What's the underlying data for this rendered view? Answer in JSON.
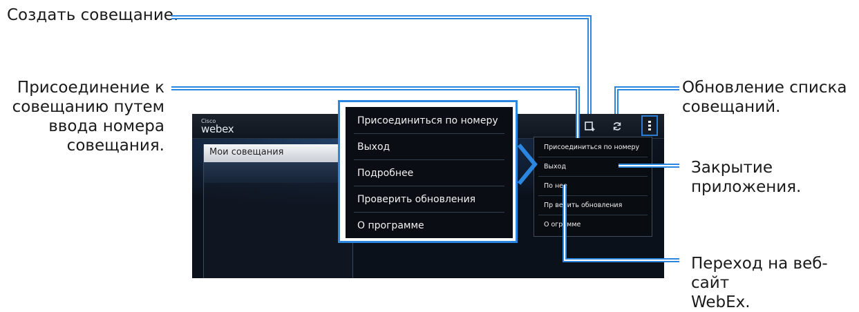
{
  "annotations": {
    "create_meeting": "Создать совещание.",
    "join_by_number": [
      "Присоединение к",
      "совещанию путем",
      "ввода номера",
      "совещания."
    ],
    "refresh_list": [
      "Обновление списка",
      "совещаний."
    ],
    "close_app": [
      "Закрытие",
      "приложения."
    ],
    "website": [
      "Переход на веб-сайт",
      "WebEx."
    ]
  },
  "app": {
    "logo_small": "Cisco",
    "logo_main": "webex",
    "panel_title": "Мои совещания",
    "icons": {
      "create": "create-meeting-icon",
      "refresh": "refresh-icon",
      "menu": "overflow-menu-icon"
    }
  },
  "menu": {
    "items": [
      "Присоединиться по номеру",
      "Выход",
      "Подробнее",
      "Проверить обновления",
      "О программе"
    ],
    "small_items": [
      "Присоединиться по номеру",
      "Выход",
      "По        нее",
      "Пр    верить обновления",
      "О    ограмме"
    ]
  },
  "colors": {
    "accent": "#2b86e0",
    "leader_line": "#2b86e0",
    "screen_bg": "#0d1420",
    "menu_bg": "#0a0d13"
  }
}
